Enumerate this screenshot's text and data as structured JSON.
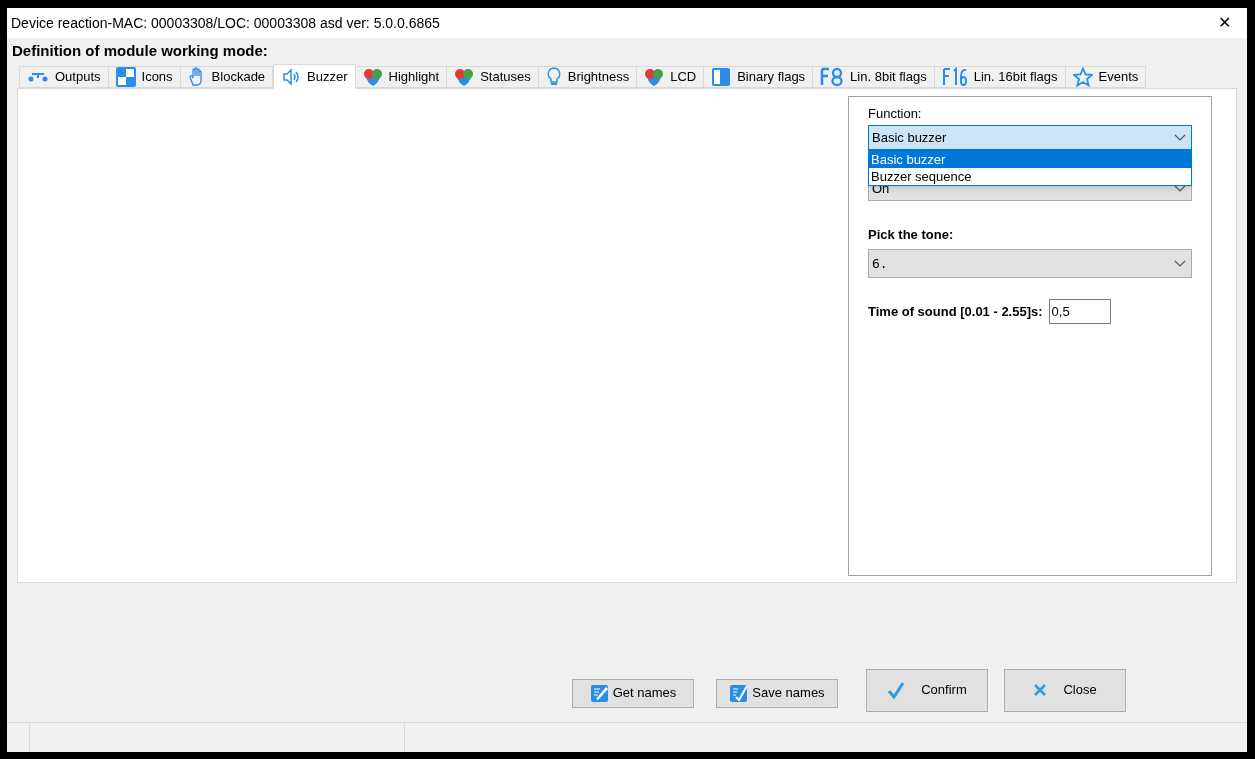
{
  "window": {
    "title": "Device reaction-MAC: 00003308/LOC: 00003308 asd ver: 5.0.0.6865",
    "close": "✕"
  },
  "heading": "Definition of module working mode:",
  "tabs": [
    {
      "label": "Outputs",
      "selected": false
    },
    {
      "label": "Icons",
      "selected": false
    },
    {
      "label": "Blockade",
      "selected": false
    },
    {
      "label": "Buzzer",
      "selected": true
    },
    {
      "label": "Highlight",
      "selected": false
    },
    {
      "label": "Statuses",
      "selected": false
    },
    {
      "label": "Brightness",
      "selected": false
    },
    {
      "label": "LCD",
      "selected": false
    },
    {
      "label": "Binary flags",
      "selected": false
    },
    {
      "label": "Lin. 8bit flags",
      "selected": false
    },
    {
      "label": "Lin. 16bit flags",
      "selected": false
    },
    {
      "label": "Events",
      "selected": false
    }
  ],
  "function": {
    "label": "Function:",
    "value": "Basic buzzer",
    "expanded": true,
    "options": [
      {
        "label": "Basic buzzer",
        "selected": true
      },
      {
        "label": "Buzzer sequence",
        "selected": false
      }
    ]
  },
  "state_combo": {
    "value": "On"
  },
  "tone": {
    "label": "Pick the tone:",
    "value": "6."
  },
  "time": {
    "label": "Time of sound [0.01 - 2.55]s:",
    "value": "0,5"
  },
  "buttons": [
    {
      "kind": "get",
      "label": "Get names"
    },
    {
      "kind": "save",
      "label": "Save names"
    },
    {
      "kind": "confirm",
      "label": "Confirm"
    },
    {
      "kind": "close",
      "label": "Close"
    }
  ]
}
